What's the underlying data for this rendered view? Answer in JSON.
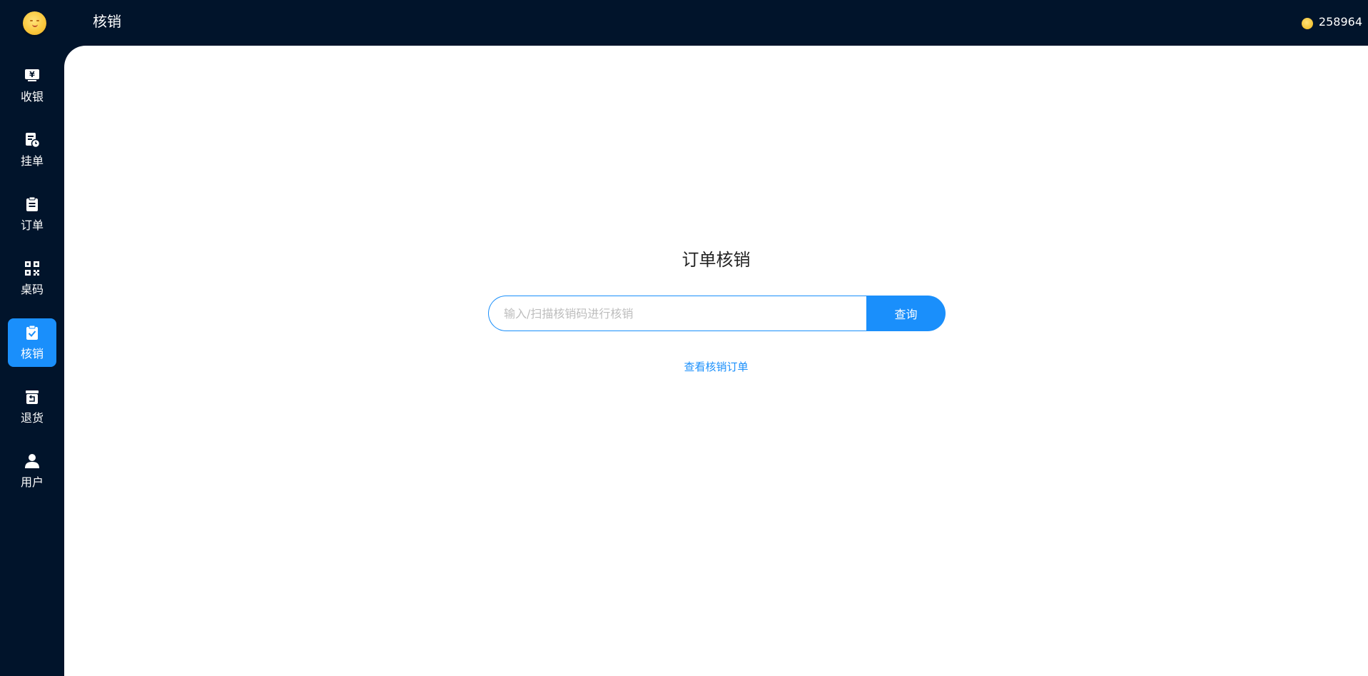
{
  "header": {
    "page_title": "核销",
    "user_name": "258964"
  },
  "sidebar": {
    "items": [
      {
        "label": "收银",
        "icon": "cashier-icon",
        "active": false
      },
      {
        "label": "挂单",
        "icon": "pending-order-icon",
        "active": false
      },
      {
        "label": "订单",
        "icon": "order-clipboard-icon",
        "active": false
      },
      {
        "label": "桌码",
        "icon": "qrcode-icon",
        "active": false
      },
      {
        "label": "核销",
        "icon": "verify-clipboard-icon",
        "active": true
      },
      {
        "label": "退货",
        "icon": "return-box-icon",
        "active": false
      },
      {
        "label": "用户",
        "icon": "user-icon",
        "active": false
      }
    ]
  },
  "main": {
    "title": "订单核销",
    "search": {
      "placeholder": "输入/扫描核销码进行核销",
      "value": "",
      "button_label": "查询"
    },
    "view_orders_link": "查看核销订单"
  },
  "colors": {
    "background_dark": "#01142b",
    "accent": "#1a8ffb",
    "content_bg": "#ffffff"
  }
}
